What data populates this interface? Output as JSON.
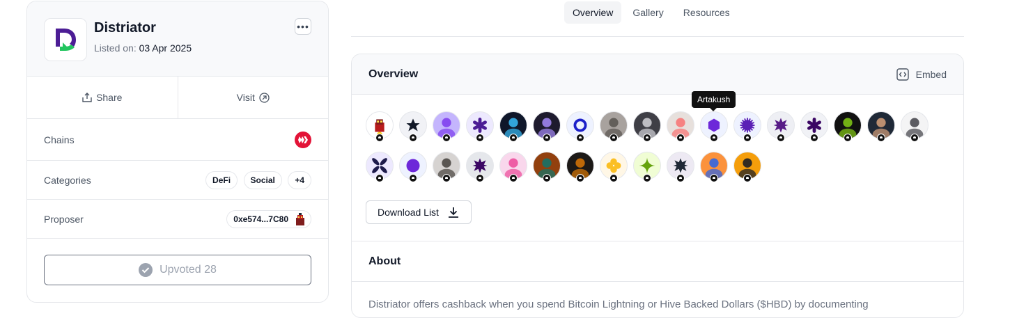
{
  "project": {
    "name": "Distriator",
    "listed_label": "Listed on:",
    "listed_date": "03 Apr 2025"
  },
  "actions": {
    "share": "Share",
    "visit": "Visit"
  },
  "details": {
    "chains_label": "Chains",
    "chain_icon": "hive-icon",
    "categories_label": "Categories",
    "categories": [
      "DeFi",
      "Social",
      "+4"
    ],
    "proposer_label": "Proposer",
    "proposer_address": "0xe574...7C80"
  },
  "upvote": {
    "label": "Upvoted 28"
  },
  "tabs": [
    "Overview",
    "Gallery",
    "Resources"
  ],
  "overview": {
    "title": "Overview",
    "embed_label": "Embed",
    "tooltip": "Artakush",
    "download_label": "Download List",
    "voters": [
      {
        "bg": "#ffffff",
        "fg": "#b91c1c",
        "kind": "pixel"
      },
      {
        "bg": "#f1f2f6",
        "fg": "#111827",
        "kind": "star"
      },
      {
        "bg": "#c4b5fd",
        "fg": "#7c3aed",
        "kind": "photo"
      },
      {
        "bg": "#ede9fe",
        "fg": "#4c1d95",
        "kind": "asterisk"
      },
      {
        "bg": "#0f172a",
        "fg": "#38bdf8",
        "kind": "photo"
      },
      {
        "bg": "#1e1b2e",
        "fg": "#a78bfa",
        "kind": "photo"
      },
      {
        "bg": "#eef2ff",
        "fg": "#1d20c9",
        "kind": "ring"
      },
      {
        "bg": "#a8a29e",
        "fg": "#57534e",
        "kind": "photo"
      },
      {
        "bg": "#3f3f46",
        "fg": "#d4d4d8",
        "kind": "photo"
      },
      {
        "bg": "#e7e0dc",
        "fg": "#f87171",
        "kind": "photo"
      },
      {
        "bg": "#eef2ff",
        "fg": "#6d28d9",
        "kind": "hex"
      },
      {
        "bg": "#eef2ff",
        "fg": "#5b21b6",
        "kind": "sun"
      },
      {
        "bg": "#eeeff4",
        "fg": "#581c87",
        "kind": "burst"
      },
      {
        "bg": "#f1f2f6",
        "fg": "#3b0764",
        "kind": "asterisk"
      },
      {
        "bg": "#111111",
        "fg": "#84cc16",
        "kind": "photo"
      },
      {
        "bg": "#1f2937",
        "fg": "#d6a07a",
        "kind": "photo"
      },
      {
        "bg": "#f4f4f5",
        "fg": "#3f3f46",
        "kind": "photo"
      },
      {
        "bg": "#ede9fe",
        "fg": "#1e1b4b",
        "kind": "x"
      },
      {
        "bg": "#eef2ff",
        "fg": "#6d28d9",
        "kind": "dot"
      },
      {
        "bg": "#d6d3d1",
        "fg": "#44403c",
        "kind": "photo"
      },
      {
        "bg": "#e5e7eb",
        "fg": "#3b0764",
        "kind": "burst"
      },
      {
        "bg": "#f9d7ec",
        "fg": "#ec4899",
        "kind": "photo"
      },
      {
        "bg": "#92400e",
        "fg": "#0f766e",
        "kind": "photo"
      },
      {
        "bg": "#1c1917",
        "fg": "#d97706",
        "kind": "photo"
      },
      {
        "bg": "#fff7e6",
        "fg": "#fbbf24",
        "kind": "cross"
      },
      {
        "bg": "#f0fdd4",
        "fg": "#65a30d",
        "kind": "spark"
      },
      {
        "bg": "#ede9f3",
        "fg": "#1f2937",
        "kind": "burst"
      },
      {
        "bg": "#fb923c",
        "fg": "#2563eb",
        "kind": "photo"
      },
      {
        "bg": "#f59e0b",
        "fg": "#111827",
        "kind": "photo"
      }
    ]
  },
  "about": {
    "title": "About",
    "text": "Distriator offers cashback when you spend Bitcoin Lightning or Hive Backed Dollars ($HBD) by documenting"
  }
}
